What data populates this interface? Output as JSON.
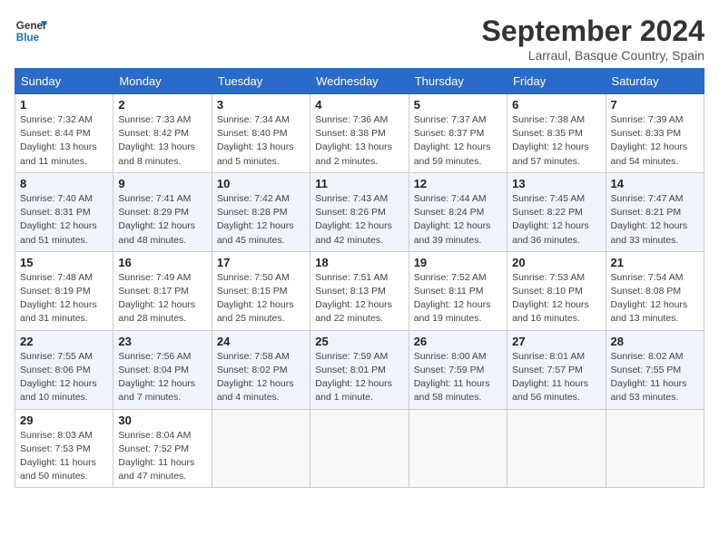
{
  "header": {
    "logo_line1": "General",
    "logo_line2": "Blue",
    "title": "September 2024",
    "location": "Larraul, Basque Country, Spain"
  },
  "weekdays": [
    "Sunday",
    "Monday",
    "Tuesday",
    "Wednesday",
    "Thursday",
    "Friday",
    "Saturday"
  ],
  "weeks": [
    [
      {
        "day": "1",
        "info": "Sunrise: 7:32 AM\nSunset: 8:44 PM\nDaylight: 13 hours and 11 minutes."
      },
      {
        "day": "2",
        "info": "Sunrise: 7:33 AM\nSunset: 8:42 PM\nDaylight: 13 hours and 8 minutes."
      },
      {
        "day": "3",
        "info": "Sunrise: 7:34 AM\nSunset: 8:40 PM\nDaylight: 13 hours and 5 minutes."
      },
      {
        "day": "4",
        "info": "Sunrise: 7:36 AM\nSunset: 8:38 PM\nDaylight: 13 hours and 2 minutes."
      },
      {
        "day": "5",
        "info": "Sunrise: 7:37 AM\nSunset: 8:37 PM\nDaylight: 12 hours and 59 minutes."
      },
      {
        "day": "6",
        "info": "Sunrise: 7:38 AM\nSunset: 8:35 PM\nDaylight: 12 hours and 57 minutes."
      },
      {
        "day": "7",
        "info": "Sunrise: 7:39 AM\nSunset: 8:33 PM\nDaylight: 12 hours and 54 minutes."
      }
    ],
    [
      {
        "day": "8",
        "info": "Sunrise: 7:40 AM\nSunset: 8:31 PM\nDaylight: 12 hours and 51 minutes."
      },
      {
        "day": "9",
        "info": "Sunrise: 7:41 AM\nSunset: 8:29 PM\nDaylight: 12 hours and 48 minutes."
      },
      {
        "day": "10",
        "info": "Sunrise: 7:42 AM\nSunset: 8:28 PM\nDaylight: 12 hours and 45 minutes."
      },
      {
        "day": "11",
        "info": "Sunrise: 7:43 AM\nSunset: 8:26 PM\nDaylight: 12 hours and 42 minutes."
      },
      {
        "day": "12",
        "info": "Sunrise: 7:44 AM\nSunset: 8:24 PM\nDaylight: 12 hours and 39 minutes."
      },
      {
        "day": "13",
        "info": "Sunrise: 7:45 AM\nSunset: 8:22 PM\nDaylight: 12 hours and 36 minutes."
      },
      {
        "day": "14",
        "info": "Sunrise: 7:47 AM\nSunset: 8:21 PM\nDaylight: 12 hours and 33 minutes."
      }
    ],
    [
      {
        "day": "15",
        "info": "Sunrise: 7:48 AM\nSunset: 8:19 PM\nDaylight: 12 hours and 31 minutes."
      },
      {
        "day": "16",
        "info": "Sunrise: 7:49 AM\nSunset: 8:17 PM\nDaylight: 12 hours and 28 minutes."
      },
      {
        "day": "17",
        "info": "Sunrise: 7:50 AM\nSunset: 8:15 PM\nDaylight: 12 hours and 25 minutes."
      },
      {
        "day": "18",
        "info": "Sunrise: 7:51 AM\nSunset: 8:13 PM\nDaylight: 12 hours and 22 minutes."
      },
      {
        "day": "19",
        "info": "Sunrise: 7:52 AM\nSunset: 8:11 PM\nDaylight: 12 hours and 19 minutes."
      },
      {
        "day": "20",
        "info": "Sunrise: 7:53 AM\nSunset: 8:10 PM\nDaylight: 12 hours and 16 minutes."
      },
      {
        "day": "21",
        "info": "Sunrise: 7:54 AM\nSunset: 8:08 PM\nDaylight: 12 hours and 13 minutes."
      }
    ],
    [
      {
        "day": "22",
        "info": "Sunrise: 7:55 AM\nSunset: 8:06 PM\nDaylight: 12 hours and 10 minutes."
      },
      {
        "day": "23",
        "info": "Sunrise: 7:56 AM\nSunset: 8:04 PM\nDaylight: 12 hours and 7 minutes."
      },
      {
        "day": "24",
        "info": "Sunrise: 7:58 AM\nSunset: 8:02 PM\nDaylight: 12 hours and 4 minutes."
      },
      {
        "day": "25",
        "info": "Sunrise: 7:59 AM\nSunset: 8:01 PM\nDaylight: 12 hours and 1 minute."
      },
      {
        "day": "26",
        "info": "Sunrise: 8:00 AM\nSunset: 7:59 PM\nDaylight: 11 hours and 58 minutes."
      },
      {
        "day": "27",
        "info": "Sunrise: 8:01 AM\nSunset: 7:57 PM\nDaylight: 11 hours and 56 minutes."
      },
      {
        "day": "28",
        "info": "Sunrise: 8:02 AM\nSunset: 7:55 PM\nDaylight: 11 hours and 53 minutes."
      }
    ],
    [
      {
        "day": "29",
        "info": "Sunrise: 8:03 AM\nSunset: 7:53 PM\nDaylight: 11 hours and 50 minutes."
      },
      {
        "day": "30",
        "info": "Sunrise: 8:04 AM\nSunset: 7:52 PM\nDaylight: 11 hours and 47 minutes."
      },
      null,
      null,
      null,
      null,
      null
    ]
  ]
}
